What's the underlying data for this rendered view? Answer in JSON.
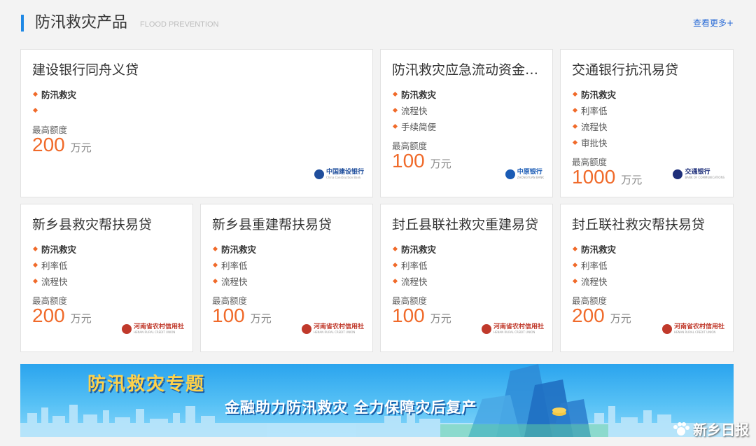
{
  "header": {
    "title": "防汛救灾产品",
    "subtitle": "FLOOD PREVENTION",
    "more": "查看更多+"
  },
  "quota_label": "最高额度",
  "unit": "万元",
  "cards": [
    {
      "name": "建设银行同舟义贷",
      "features": [
        "防汛救灾",
        ""
      ],
      "amount": "200",
      "bank_logo_text": "中国建设银行",
      "bank_logo_sub": "China Construction Bank",
      "logo_color": "#1f4e9c"
    },
    {
      "name": "防汛救灾应急流动资金…",
      "features": [
        "防汛救灾",
        "流程快",
        "手续简便"
      ],
      "amount": "100",
      "bank_logo_text": "中原银行",
      "bank_logo_sub": "ZHONGYUAN BANK",
      "logo_color": "#1a5bb5"
    },
    {
      "name": "交通银行抗汛易贷",
      "features": [
        "防汛救灾",
        "利率低",
        "流程快",
        "审批快"
      ],
      "amount": "1000",
      "bank_logo_text": "交通银行",
      "bank_logo_sub": "BANK OF COMMUNICATIONS",
      "logo_color": "#1e2f7a"
    },
    {
      "name": "新乡县救灾帮扶易贷",
      "features": [
        "防汛救灾",
        "利率低",
        "流程快"
      ],
      "amount": "200",
      "bank_logo_text": "河南省农村信用社",
      "bank_logo_sub": "HENAN RURAL CREDIT UNION",
      "logo_color": "#c0392b"
    },
    {
      "name": "新乡县重建帮扶易贷",
      "features": [
        "防汛救灾",
        "利率低",
        "流程快"
      ],
      "amount": "100",
      "bank_logo_text": "河南省农村信用社",
      "bank_logo_sub": "HENAN RURAL CREDIT UNION",
      "logo_color": "#c0392b"
    },
    {
      "name": "封丘县联社救灾重建易贷",
      "features": [
        "防汛救灾",
        "利率低",
        "流程快"
      ],
      "amount": "100",
      "bank_logo_text": "河南省农村信用社",
      "bank_logo_sub": "HENAN RURAL CREDIT UNION",
      "logo_color": "#c0392b"
    },
    {
      "name": "封丘联社救灾帮扶易贷",
      "features": [
        "防汛救灾",
        "利率低",
        "流程快"
      ],
      "amount": "200",
      "bank_logo_text": "河南省农村信用社",
      "bank_logo_sub": "HENAN RURAL CREDIT UNION",
      "logo_color": "#c0392b"
    }
  ],
  "banner": {
    "title": "防汛救灾专题",
    "slogan": "金融助力防汛救灾  全力保障灾后复产"
  },
  "watermark": "新乡日报",
  "colors": {
    "accent": "#1e88e5",
    "amount": "#f06a2a",
    "bullet": "#f06a2a",
    "link": "#2b6cd6"
  }
}
